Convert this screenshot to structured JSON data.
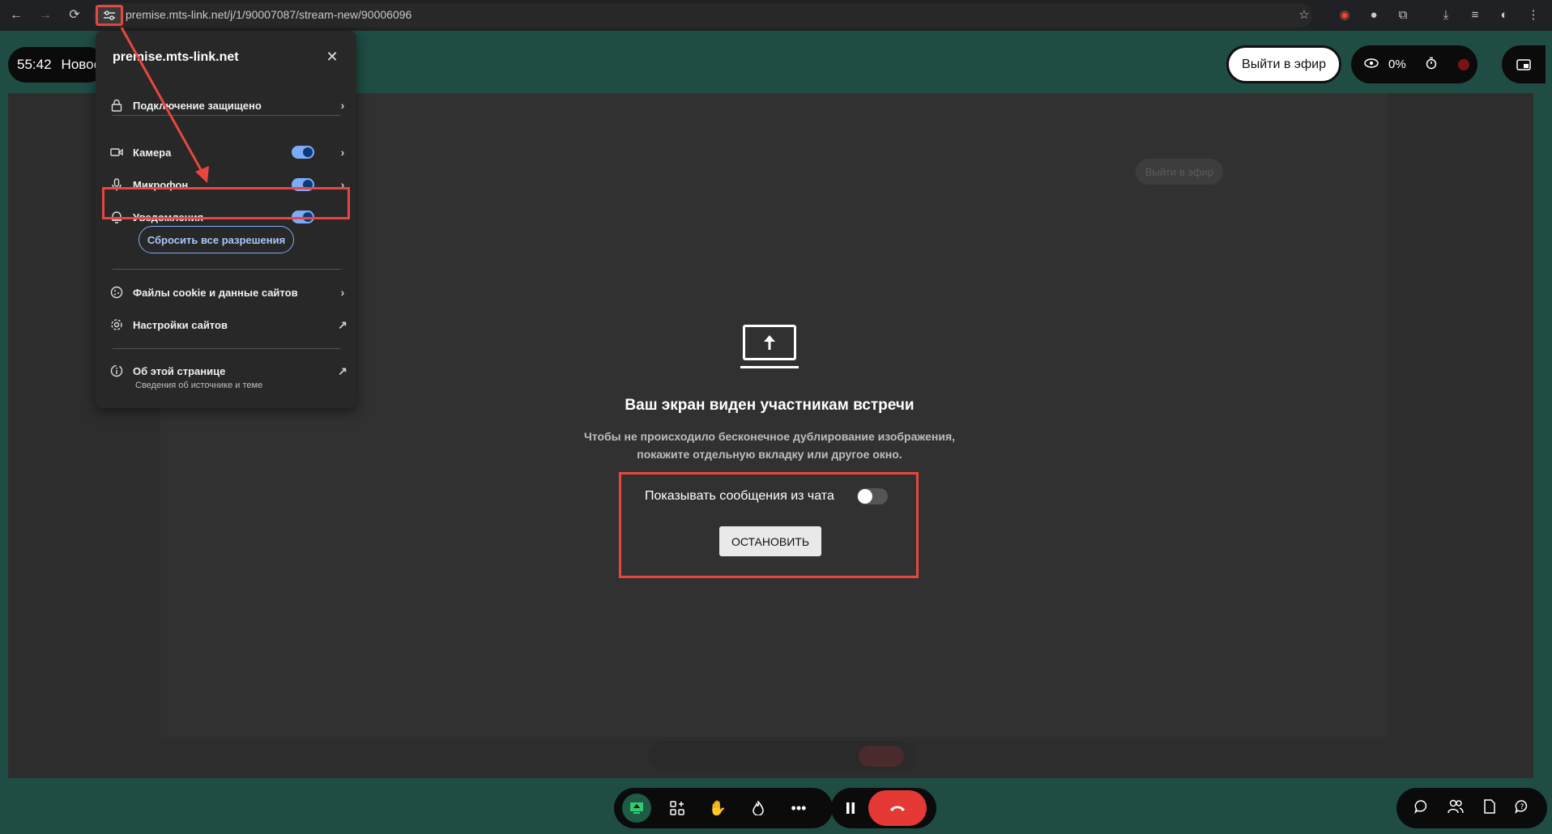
{
  "browser": {
    "url": "premise.mts-link.net/j/1/90007087/stream-new/90006096",
    "nav": {
      "back": "←",
      "forward": "→",
      "reload": "⟳"
    }
  },
  "header": {
    "timer": "55:42",
    "title": "Новое",
    "on_air_label": "Выйти в эфир",
    "views_percent": "0%"
  },
  "popup": {
    "site": "premise.mts-link.net",
    "connection": "Подключение защищено",
    "camera": "Камера",
    "microphone": "Микрофон",
    "notifications": "Уведомления",
    "reset": "Сбросить все разрешения",
    "cookies": "Файлы cookie и данные сайтов",
    "site_settings": "Настройки сайтов",
    "about": "Об этой странице",
    "about_sub": "Сведения об источнике и теме",
    "camera_enabled": true,
    "microphone_enabled": true,
    "notifications_enabled": true
  },
  "share": {
    "title": "Ваш экран виден участникам встречи",
    "desc_line1": "Чтобы не происходило бесконечное дублирование изображения,",
    "desc_line2": "покажите отдельную вкладку или другое окно.",
    "chat_label": "Показывать сообщения из чата",
    "chat_enabled": false,
    "stop_label": "ОСТАНОВИТЬ"
  },
  "ghost": {
    "on_air_label": "Выйти в эфир"
  },
  "colors": {
    "background": "#1f4d44",
    "highlight": "#e8463f",
    "end_call": "#e53935",
    "toggle_on": "#7cacf8"
  }
}
